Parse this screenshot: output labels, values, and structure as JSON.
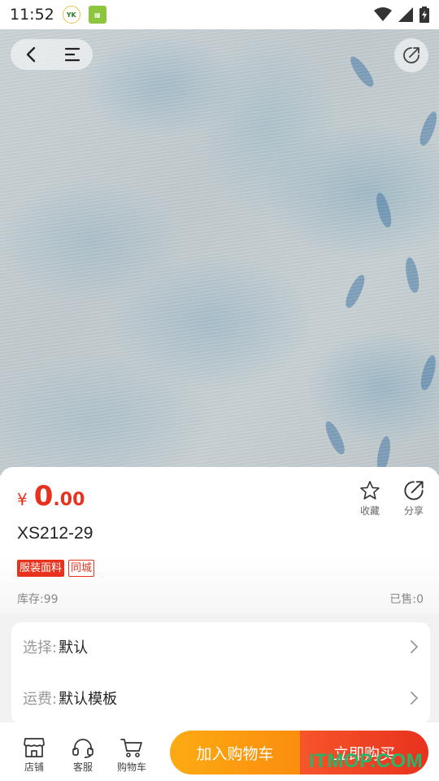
{
  "status_bar": {
    "time": "11:52"
  },
  "product": {
    "currency": "¥",
    "price_int": "0",
    "price_dec": ".00",
    "name": "XS212-29",
    "tags": [
      "服装面料",
      "同城"
    ],
    "stock": "库存:99",
    "sold": "已售:0"
  },
  "actions": {
    "favorite": "收藏",
    "share": "分享"
  },
  "options": {
    "select_key": "选择:",
    "select_value": "默认",
    "shipping_key": "运费:",
    "shipping_value": "默认模板"
  },
  "bottom_bar": {
    "shop": "店铺",
    "service": "客服",
    "cart": "购物车",
    "add_to_cart": "加入购物车",
    "buy_now": "立即购买"
  },
  "watermark": "ITMOP.COM",
  "colors": {
    "accent_red": "#e8321e",
    "cart_orange": "#fb8d0e",
    "watermark_green": "#2ab46a"
  }
}
